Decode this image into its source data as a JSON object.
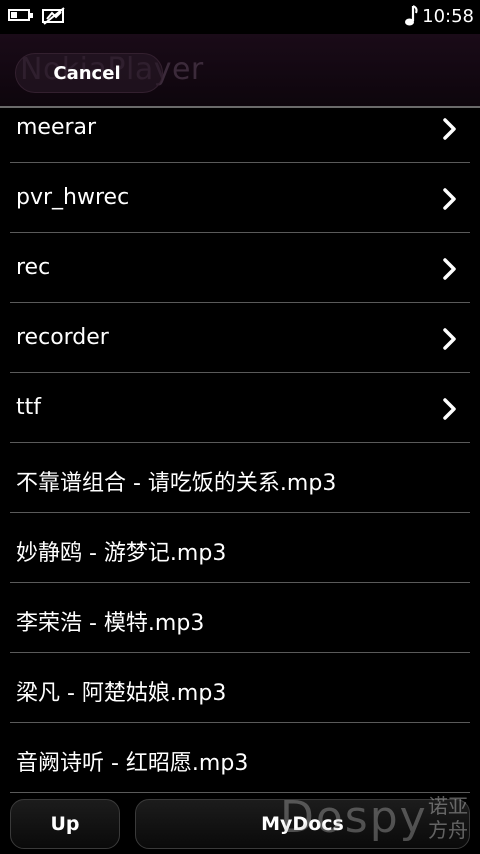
{
  "status_bar": {
    "time": "10:58",
    "icons": [
      "battery-icon",
      "mute-icon",
      "music-note-icon"
    ]
  },
  "title_bar": {
    "title": "NokiaPlayer",
    "cancel_label": "Cancel"
  },
  "list": {
    "items": [
      {
        "label": "meerar",
        "folder": true
      },
      {
        "label": "pvr_hwrec",
        "folder": true
      },
      {
        "label": "rec",
        "folder": true
      },
      {
        "label": "recorder",
        "folder": true
      },
      {
        "label": "ttf",
        "folder": true
      },
      {
        "label": "不靠谱组合 - 请吃饭的关系.mp3",
        "folder": false
      },
      {
        "label": "妙静鸥 - 游梦记.mp3",
        "folder": false
      },
      {
        "label": "李荣浩 - 模特.mp3",
        "folder": false
      },
      {
        "label": "梁凡 - 阿楚姑娘.mp3",
        "folder": false
      },
      {
        "label": "音阙诗听 - 红昭愿.mp3",
        "folder": false
      }
    ]
  },
  "toolbar": {
    "up_label": "Up",
    "mydocs_label": "MyDocs"
  },
  "watermark": {
    "main": "Dospy",
    "side": "诺亚方舟"
  }
}
